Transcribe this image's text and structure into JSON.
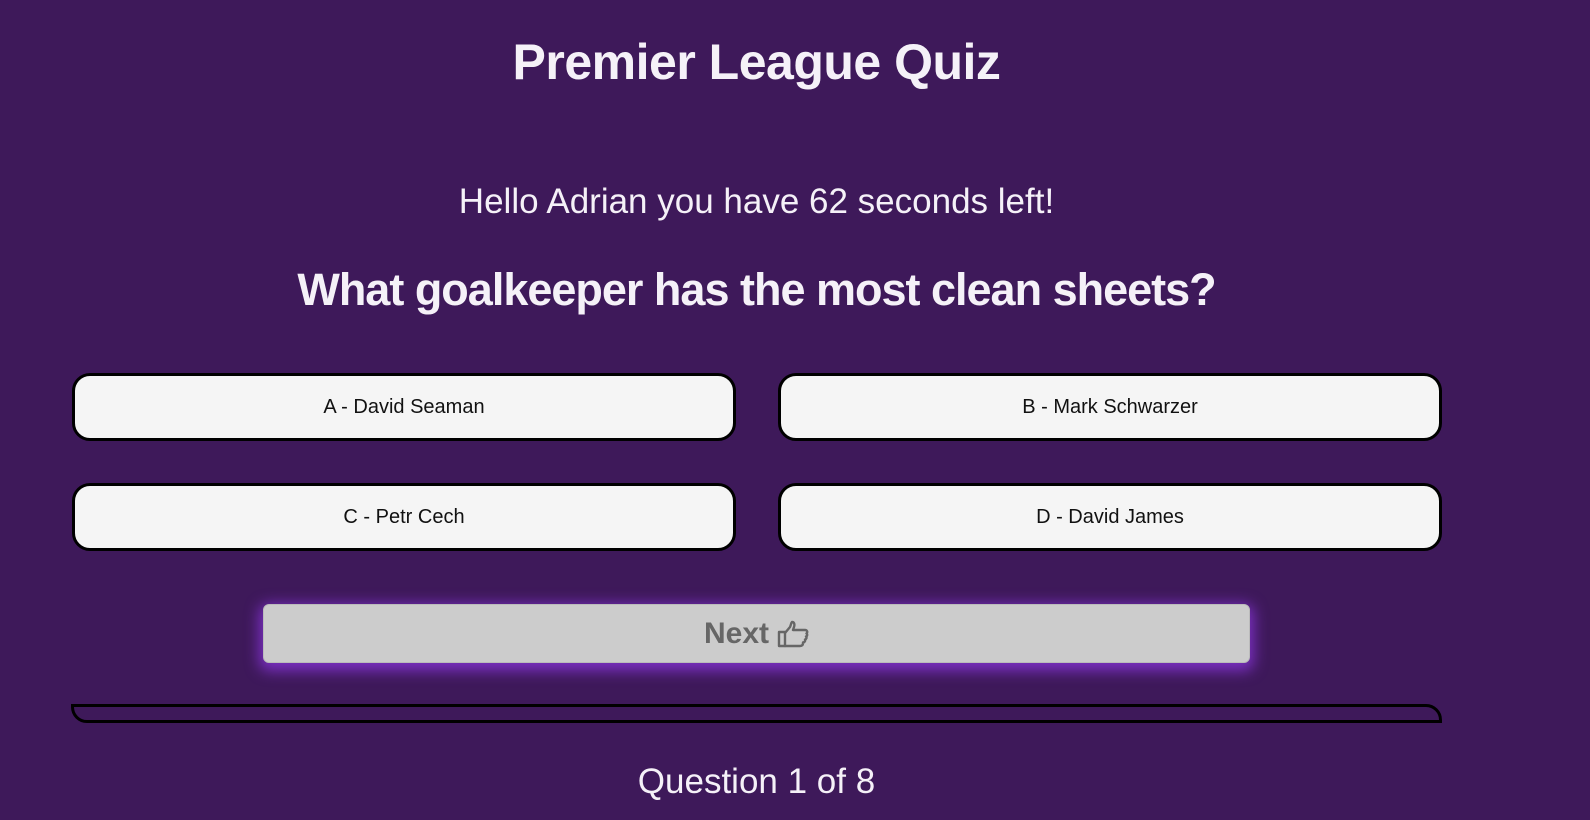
{
  "header": {
    "title": "Premier League Quiz"
  },
  "status": {
    "greeting": "Hello Adrian you have 62 seconds left!"
  },
  "quiz": {
    "question": "What goalkeeper has the most clean sheets?",
    "answers": [
      "A - David Seaman",
      "B - Mark Schwarzer",
      "C - Petr Cech",
      "D - David James"
    ],
    "next_label": "Next",
    "next_icon": "pointing-hand-right-icon",
    "progress_fraction": 0,
    "counter": "Question 1 of 8"
  },
  "colors": {
    "background": "#3e195a",
    "answer_background": "#f5f5f5",
    "next_background": "#cccccc",
    "next_glow": "#7a2fc0",
    "text": "#f5f1f8"
  }
}
